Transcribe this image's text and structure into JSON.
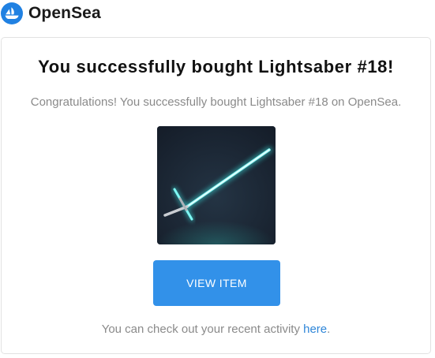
{
  "header": {
    "brand_name": "OpenSea",
    "logo_icon": "opensea-sailboat-icon",
    "logo_color": "#2081E2"
  },
  "card": {
    "title": "You successfully bought Lightsaber #18!",
    "subtitle": "Congratulations! You successfully bought Lightsaber #18 on OpenSea.",
    "image_description_icon": "lightsaber-item-image",
    "view_button_label": "VIEW ITEM",
    "footer_prefix": "You can check out your recent activity ",
    "footer_link": "here",
    "footer_suffix": "."
  },
  "colors": {
    "button": "#3291E9",
    "link": "#2F86D8",
    "muted_text": "#8A8A8A",
    "saber_glow": "#5FF4F0"
  }
}
